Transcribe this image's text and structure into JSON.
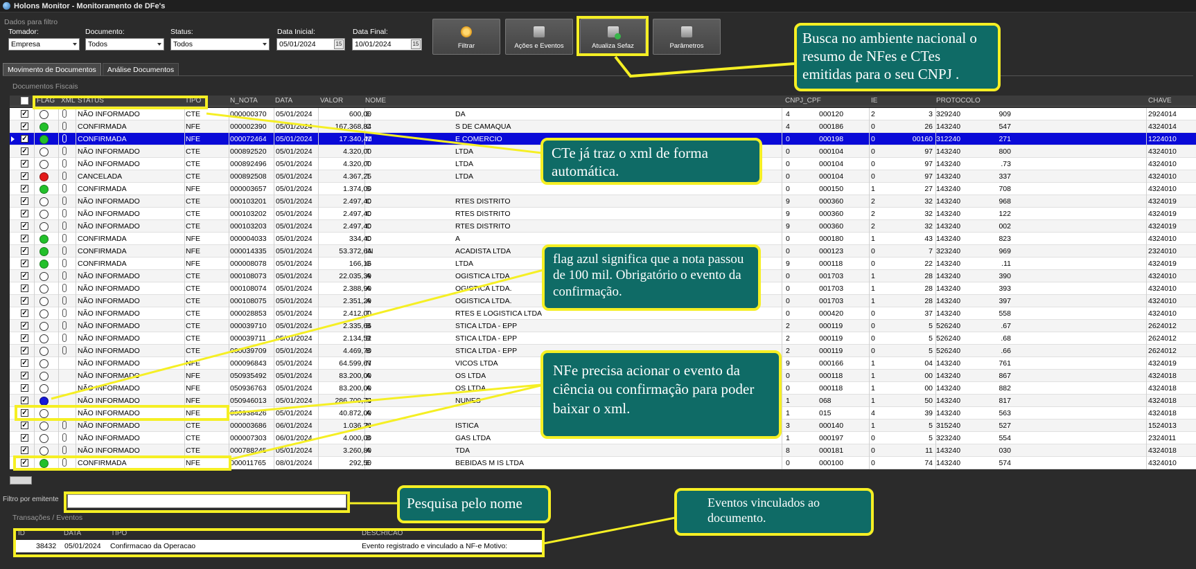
{
  "window": {
    "title": "Holons Monitor - Monitoramento de DFe's"
  },
  "filters": {
    "group_title": "Dados para filtro",
    "tomador": {
      "label": "Tomador:",
      "value": "Empresa"
    },
    "documento": {
      "label": "Documento:",
      "value": "Todos"
    },
    "status": {
      "label": "Status:",
      "value": "Todos"
    },
    "data_inicial": {
      "label": "Data Inicial:",
      "value": "05/01/2024",
      "icon_text": "15"
    },
    "data_final": {
      "label": "Data Final:",
      "value": "10/01/2024",
      "icon_text": "15"
    }
  },
  "toolbar": {
    "filtrar": "Filtrar",
    "acoes": "Ações e Eventos",
    "atualiza": "Atualiza Sefaz",
    "parametros": "Parâmetros"
  },
  "tabs": [
    "Movimento de Documentos",
    "Análise Documentos"
  ],
  "documents": {
    "section_title": "Documentos Fiscais",
    "columns": [
      "FLAG",
      "XML",
      "STATUS",
      "TIPO",
      "N_NOTA",
      "DATA",
      "VALOR",
      "NOME",
      "CNPJ_CPF",
      "IE",
      "PROTOCOLO",
      "CHAVE"
    ],
    "rows": [
      {
        "flag": "none",
        "status": "NÃO INFORMADO",
        "tipo": "CTE",
        "nota": "000000370",
        "data": "05/01/2024",
        "valor": "600,00",
        "nome1": "E",
        "nome2": "DA",
        "cnpj1": "4",
        "cnpj2": "000120",
        "ie1": "2",
        "ie2": "3",
        "prot1": "329240",
        "prot2": "909",
        "chave": "2924014"
      },
      {
        "flag": "green",
        "status": "CONFIRMADA",
        "tipo": "NFE",
        "nota": "000002390",
        "data": "05/01/2024",
        "valor": "167.368,84",
        "nome1": "C",
        "nome2": "S DE CAMAQUA",
        "cnpj1": "4",
        "cnpj2": "000186",
        "ie1": "0",
        "ie2": "26",
        "prot1": "143240",
        "prot2": "547",
        "chave": "4324014"
      },
      {
        "flag": "green",
        "status": "CONFIRMADA",
        "tipo": "NFE",
        "nota": "000072464",
        "data": "05/01/2024",
        "valor": "17.340,41",
        "nome1": "M",
        "nome2": "E COMERCIO",
        "cnpj1": "0",
        "cnpj2": "000198",
        "ie1": "0",
        "ie2": "00160",
        "prot1": "312240",
        "prot2": "271",
        "chave": "1224010",
        "selected": true
      },
      {
        "flag": "none",
        "status": "NÃO INFORMADO",
        "tipo": "CTE",
        "nota": "000892520",
        "data": "05/01/2024",
        "valor": "4.320,00",
        "nome1": "T",
        "nome2": "LTDA",
        "cnpj1": "0",
        "cnpj2": "000104",
        "ie1": "0",
        "ie2": "97",
        "prot1": "143240",
        "prot2": "800",
        "chave": "4324010"
      },
      {
        "flag": "none",
        "status": "NÃO INFORMADO",
        "tipo": "CTE",
        "nota": "000892496",
        "data": "05/01/2024",
        "valor": "4.320,00",
        "nome1": "T",
        "nome2": "LTDA",
        "cnpj1": "0",
        "cnpj2": "000104",
        "ie1": "0",
        "ie2": "97",
        "prot1": "143240",
        "prot2": ".73",
        "chave": "4324010"
      },
      {
        "flag": "red",
        "status": "CANCELADA",
        "tipo": "CTE",
        "nota": "000892508",
        "data": "05/01/2024",
        "valor": "4.367,25",
        "nome1": "T",
        "nome2": "LTDA",
        "cnpj1": "0",
        "cnpj2": "000104",
        "ie1": "0",
        "ie2": "97",
        "prot1": "143240",
        "prot2": "337",
        "chave": "4324010"
      },
      {
        "flag": "green",
        "status": "CONFIRMADA",
        "tipo": "NFE",
        "nota": "000003657",
        "data": "05/01/2024",
        "valor": "1.374,00",
        "nome1": "S",
        "nome2": "",
        "cnpj1": "0",
        "cnpj2": "000150",
        "ie1": "1",
        "ie2": "27",
        "prot1": "143240",
        "prot2": "708",
        "chave": "4324010"
      },
      {
        "flag": "none",
        "status": "NÃO INFORMADO",
        "tipo": "CTE",
        "nota": "000103201",
        "data": "05/01/2024",
        "valor": "2.497,40",
        "nome1": "C",
        "nome2": "RTES DISTRITO",
        "cnpj1": "9",
        "cnpj2": "000360",
        "ie1": "2",
        "ie2": "32",
        "prot1": "143240",
        "prot2": "968",
        "chave": "4324019"
      },
      {
        "flag": "none",
        "status": "NÃO INFORMADO",
        "tipo": "CTE",
        "nota": "000103202",
        "data": "05/01/2024",
        "valor": "2.497,40",
        "nome1": "C",
        "nome2": "RTES DISTRITO",
        "cnpj1": "9",
        "cnpj2": "000360",
        "ie1": "2",
        "ie2": "32",
        "prot1": "143240",
        "prot2": "122",
        "chave": "4324019"
      },
      {
        "flag": "none",
        "status": "NÃO INFORMADO",
        "tipo": "CTE",
        "nota": "000103203",
        "data": "05/01/2024",
        "valor": "2.497,40",
        "nome1": "C",
        "nome2": "RTES DISTRITO",
        "cnpj1": "9",
        "cnpj2": "000360",
        "ie1": "2",
        "ie2": "32",
        "prot1": "143240",
        "prot2": "002",
        "chave": "4324019"
      },
      {
        "flag": "green",
        "status": "CONFIRMADA",
        "tipo": "NFE",
        "nota": "000004033",
        "data": "05/01/2024",
        "valor": "334,40",
        "nome1": "C",
        "nome2": "A",
        "cnpj1": "0",
        "cnpj2": "000180",
        "ie1": "1",
        "ie2": "43",
        "prot1": "143240",
        "prot2": "823",
        "chave": "4324010"
      },
      {
        "flag": "green",
        "status": "CONFIRMADA",
        "tipo": "NFE",
        "nota": "000014335",
        "data": "05/01/2024",
        "valor": "53.372,64",
        "nome1": "IN",
        "nome2": "ACADISTA LTDA",
        "cnpj1": "0",
        "cnpj2": "000123",
        "ie1": "0",
        "ie2": "7",
        "prot1": "323240",
        "prot2": "969",
        "chave": "2324010"
      },
      {
        "flag": "green",
        "status": "CONFIRMADA",
        "tipo": "NFE",
        "nota": "000008078",
        "data": "05/01/2024",
        "valor": "166,16",
        "nome1": "G",
        "nome2": "LTDA",
        "cnpj1": "9",
        "cnpj2": "000118",
        "ie1": "0",
        "ie2": "22",
        "prot1": "143240",
        "prot2": ".11",
        "chave": "4324019"
      },
      {
        "flag": "none",
        "status": "NÃO INFORMADO",
        "tipo": "CTE",
        "nota": "000108073",
        "data": "05/01/2024",
        "valor": "22.035,39",
        "nome1": "A",
        "nome2": "OGISTICA LTDA",
        "cnpj1": "0",
        "cnpj2": "001703",
        "ie1": "1",
        "ie2": "28",
        "prot1": "143240",
        "prot2": "390",
        "chave": "4324010"
      },
      {
        "flag": "none",
        "status": "NÃO INFORMADO",
        "tipo": "CTE",
        "nota": "000108074",
        "data": "05/01/2024",
        "valor": "2.388,90",
        "nome1": "A",
        "nome2": "OGISTICA LTDA.",
        "cnpj1": "0",
        "cnpj2": "001703",
        "ie1": "1",
        "ie2": "28",
        "prot1": "143240",
        "prot2": "393",
        "chave": "4324010"
      },
      {
        "flag": "none",
        "status": "NÃO INFORMADO",
        "tipo": "CTE",
        "nota": "000108075",
        "data": "05/01/2024",
        "valor": "2.351,29",
        "nome1": "A",
        "nome2": "OGISTICA LTDA.",
        "cnpj1": "0",
        "cnpj2": "001703",
        "ie1": "1",
        "ie2": "28",
        "prot1": "143240",
        "prot2": "397",
        "chave": "4324010"
      },
      {
        "flag": "none",
        "status": "NÃO INFORMADO",
        "tipo": "CTE",
        "nota": "000028853",
        "data": "05/01/2024",
        "valor": "2.412,00",
        "nome1": "T",
        "nome2": "RTES E LOGISTICA LTDA",
        "cnpj1": "0",
        "cnpj2": "000420",
        "ie1": "0",
        "ie2": "37",
        "prot1": "143240",
        "prot2": "558",
        "chave": "4324010"
      },
      {
        "flag": "none",
        "status": "NÃO INFORMADO",
        "tipo": "CTE",
        "nota": "000039710",
        "data": "05/01/2024",
        "valor": "2.335,66",
        "nome1": "B",
        "nome2": "STICA LTDA - EPP",
        "cnpj1": "2",
        "cnpj2": "000119",
        "ie1": "0",
        "ie2": "5",
        "prot1": "526240",
        "prot2": ".67",
        "chave": "2624012"
      },
      {
        "flag": "none",
        "status": "NÃO INFORMADO",
        "tipo": "CTE",
        "nota": "000039711",
        "data": "05/01/2024",
        "valor": "2.134,52",
        "nome1": "B",
        "nome2": "STICA LTDA - EPP",
        "cnpj1": "2",
        "cnpj2": "000119",
        "ie1": "0",
        "ie2": "5",
        "prot1": "526240",
        "prot2": ".68",
        "chave": "2624012"
      },
      {
        "flag": "none",
        "status": "NÃO INFORMADO",
        "tipo": "CTE",
        "nota": "000039709",
        "data": "05/01/2024",
        "valor": "4.469,70",
        "nome1": "B",
        "nome2": "STICA LTDA - EPP",
        "cnpj1": "2",
        "cnpj2": "000119",
        "ie1": "0",
        "ie2": "5",
        "prot1": "526240",
        "prot2": ".66",
        "chave": "2624012"
      },
      {
        "flag": "none",
        "status": "NÃO INFORMADO",
        "tipo": "NFE",
        "nota": "000096843",
        "data": "05/01/2024",
        "valor": "64.599,67",
        "nome1": "N",
        "nome2": "VICOS LTDA",
        "cnpj1": "9",
        "cnpj2": "000166",
        "ie1": "1",
        "ie2": "04",
        "prot1": "143240",
        "prot2": "761",
        "chave": "4324019",
        "noclip": true
      },
      {
        "flag": "none",
        "status": "NÃO INFORMADO",
        "tipo": "NFE",
        "nota": "050935492",
        "data": "05/01/2024",
        "valor": "83.200,00",
        "nome1": "A",
        "nome2": "OS LTDA",
        "cnpj1": "0",
        "cnpj2": "000118",
        "ie1": "1",
        "ie2": "00",
        "prot1": "143240",
        "prot2": "867",
        "chave": "4324018",
        "noclip": true
      },
      {
        "flag": "none",
        "status": "NÃO INFORMADO",
        "tipo": "NFE",
        "nota": "050936763",
        "data": "05/01/2024",
        "valor": "83.200,00",
        "nome1": "A",
        "nome2": "OS LTDA",
        "cnpj1": "0",
        "cnpj2": "000118",
        "ie1": "1",
        "ie2": "00",
        "prot1": "143240",
        "prot2": "882",
        "chave": "4324018",
        "noclip": true
      },
      {
        "flag": "blue",
        "status": "NÃO INFORMADO",
        "tipo": "NFE",
        "nota": "050946013",
        "data": "05/01/2024",
        "valor": "286.709,73",
        "nome1": "N",
        "nome2": "NUNES",
        "cnpj1": "1",
        "cnpj2": "068",
        "ie1": "1",
        "ie2": "50",
        "prot1": "143240",
        "prot2": "817",
        "chave": "4324018",
        "noclip": true
      },
      {
        "flag": "none",
        "status": "NÃO INFORMADO",
        "tipo": "NFE",
        "nota": "050938426",
        "data": "05/01/2024",
        "valor": "40.872,00",
        "nome1": "A",
        "nome2": "",
        "cnpj1": "1",
        "cnpj2": "015",
        "ie1": "4",
        "ie2": "39",
        "prot1": "143240",
        "prot2": "563",
        "chave": "4324018",
        "noclip": true
      },
      {
        "flag": "none",
        "status": "NÃO INFORMADO",
        "tipo": "CTE",
        "nota": "000003686",
        "data": "06/01/2024",
        "valor": "1.036,26",
        "nome1": "N",
        "nome2": "ISTICA",
        "cnpj1": "3",
        "cnpj2": "000140",
        "ie1": "1",
        "ie2": "5",
        "prot1": "315240",
        "prot2": "527",
        "chave": "1524013"
      },
      {
        "flag": "none",
        "status": "NÃO INFORMADO",
        "tipo": "CTE",
        "nota": "000007303",
        "data": "06/01/2024",
        "valor": "4.000,00",
        "nome1": "B",
        "nome2": "GAS LTDA",
        "cnpj1": "1",
        "cnpj2": "000197",
        "ie1": "0",
        "ie2": "5",
        "prot1": "323240",
        "prot2": "554",
        "chave": "2324011"
      },
      {
        "flag": "none",
        "status": "NÃO INFORMADO",
        "tipo": "CTE",
        "nota": "000788245",
        "data": "05/01/2024",
        "valor": "3.260,80",
        "nome1": "A",
        "nome2": "TDA",
        "cnpj1": "8",
        "cnpj2": "000181",
        "ie1": "0",
        "ie2": "11",
        "prot1": "143240",
        "prot2": "030",
        "chave": "4324018"
      },
      {
        "flag": "green",
        "status": "CONFIRMADA",
        "tipo": "NFE",
        "nota": "000011765",
        "data": "08/01/2024",
        "valor": "292,50",
        "nome1": "E",
        "nome2": "BEBIDAS M          IS LTDA",
        "cnpj1": "0",
        "cnpj2": "000100",
        "ie1": "0",
        "ie2": "74",
        "prot1": "143240",
        "prot2": "574",
        "chave": "4324010"
      }
    ]
  },
  "filter_emitente": {
    "label": "Filtro por emitente",
    "value": ""
  },
  "events": {
    "section_title": "Transações / Eventos",
    "columns": [
      "ID",
      "DATA",
      "TIPO",
      "DESCRICAO"
    ],
    "row": {
      "id": "38432",
      "data": "05/01/2024",
      "tipo": "Confirmacao da Operacao",
      "descricao": "Evento registrado e vinculado a NF-e Motivo:"
    }
  },
  "annotations": {
    "sefaz": "Busca no ambiente nacional o resumo de NFes e CTes emitidas para o seu CNPJ .",
    "cte_xml": "CTe já traz o xml de forma automática.",
    "flag_azul": "flag azul significa que a nota passou de 100 mil. Obrigatório o evento da confirmação.",
    "nfe_evento": "NFe precisa acionar o evento da ciência ou confirmação para poder baixar o xml.",
    "pesquisa": "Pesquisa pelo nome",
    "eventos": "Eventos vinculados ao documento."
  },
  "colors": {
    "highlight": "#f5ef24",
    "callout_bg": "#0f6b66",
    "selected_row": "#0a0ad8"
  }
}
